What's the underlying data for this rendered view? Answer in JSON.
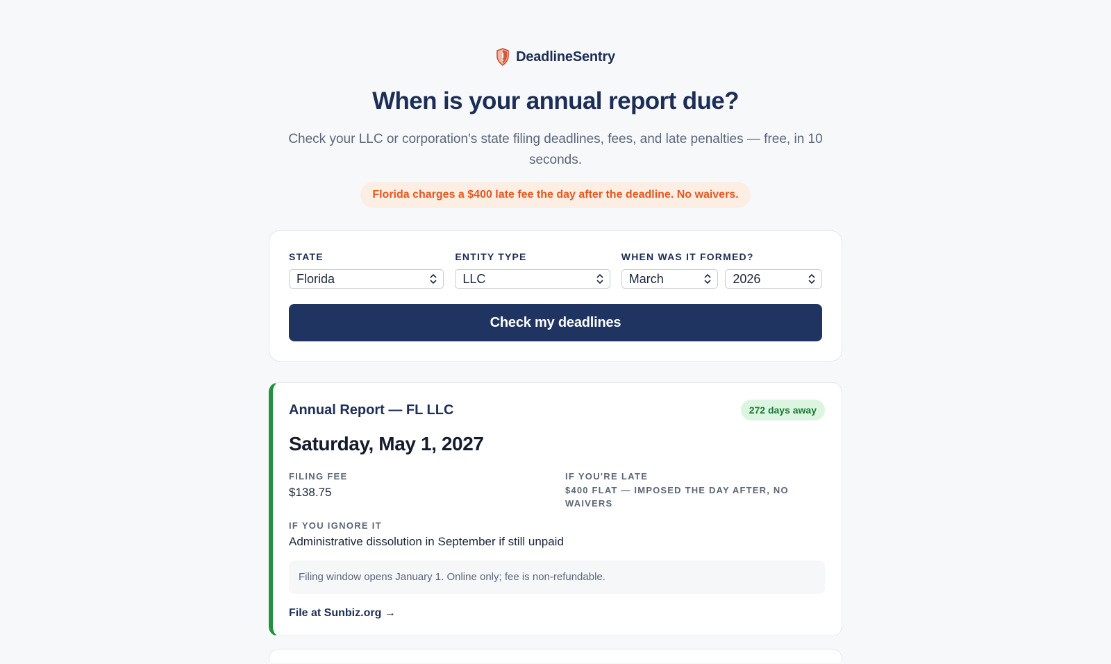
{
  "brand": {
    "name": "DeadlineSentry",
    "icon": "shield-icon"
  },
  "hero": {
    "headline": "When is your annual report due?",
    "subhead": "Check your LLC or corporation's state filing deadlines, fees, and late penalties — free, in 10 seconds.",
    "warning": "Florida charges a $400 late fee the day after the deadline. No waivers."
  },
  "form": {
    "state_label": "State",
    "state_value": "Florida",
    "entity_label": "Entity type",
    "entity_value": "LLC",
    "formed_label": "When was it formed?",
    "formed_month": "March",
    "formed_year": "2026",
    "submit_label": "Check my deadlines"
  },
  "result": {
    "title": "Annual Report — FL LLC",
    "days_away": "272 days away",
    "due_date": "Saturday, May 1, 2027",
    "filing_fee_label": "Filing fee",
    "filing_fee_value": "$138.75",
    "late_label": "If you're late",
    "late_value": "$400 flat — imposed the day after, no waivers",
    "ignore_label": "If you ignore it",
    "ignore_value": "Administrative dissolution in September if still unpaid",
    "note": "Filing window opens January 1. Online only; fee is non-refundable.",
    "link_label": "File at Sunbiz.org →"
  },
  "colors": {
    "navy": "#1f3460",
    "accent_orange": "#e4571f",
    "success_green": "#21913d"
  }
}
